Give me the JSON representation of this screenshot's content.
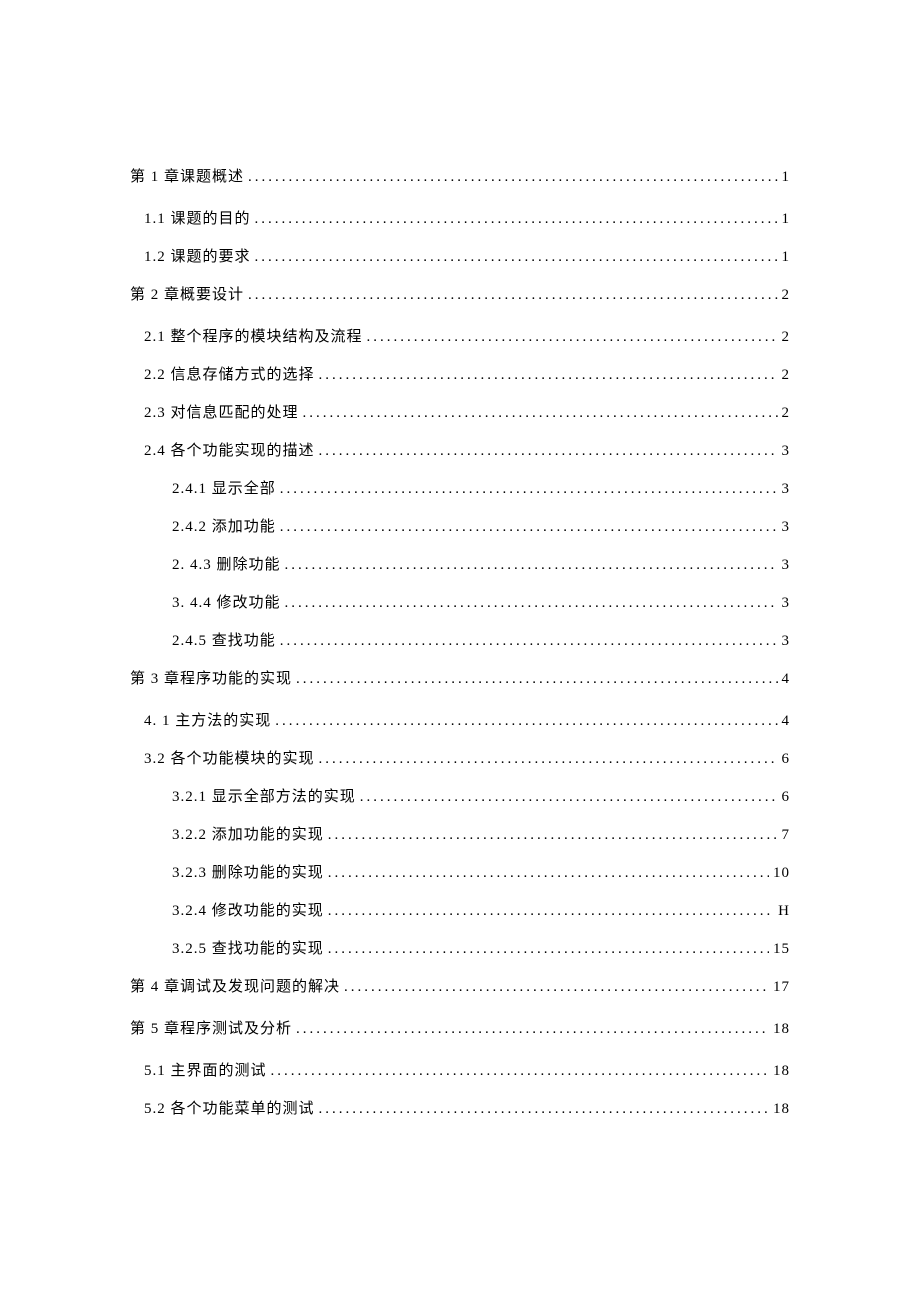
{
  "toc": [
    {
      "level": 0,
      "title": "第 1 章课题概述",
      "page": "1"
    },
    {
      "level": 1,
      "title": "1.1  课题的目的",
      "page": "1"
    },
    {
      "level": 1,
      "title": "1.2  课题的要求",
      "page": "1"
    },
    {
      "level": 0,
      "title": "第 2 章概要设计",
      "page": "2"
    },
    {
      "level": 1,
      "title": "2.1 整个程序的模块结构及流程",
      "page": "2"
    },
    {
      "level": 1,
      "title": "2.2 信息存储方式的选择",
      "page": "2"
    },
    {
      "level": 1,
      "title": "2.3 对信息匹配的处理",
      "page": "2"
    },
    {
      "level": 1,
      "title": "2.4 各个功能实现的描述",
      "page": "3"
    },
    {
      "level": 2,
      "title": "2.4.1 显示全部",
      "page": "3"
    },
    {
      "level": 2,
      "title": "2.4.2 添加功能",
      "page": "3"
    },
    {
      "level": 2,
      "title": "2.  4.3 删除功能",
      "page": "3"
    },
    {
      "level": 2,
      "title": "3.  4.4 修改功能",
      "page": "3"
    },
    {
      "level": 2,
      "title": "2.4.5 查找功能",
      "page": "3"
    },
    {
      "level": 0,
      "title": "第 3 章程序功能的实现",
      "page": "4"
    },
    {
      "level": 1,
      "title": "4.  1 主方法的实现",
      "page": "4"
    },
    {
      "level": 1,
      "title": "3.2 各个功能模块的实现",
      "page": "6"
    },
    {
      "level": 2,
      "title": "3.2.1 显示全部方法的实现",
      "page": "6"
    },
    {
      "level": 2,
      "title": "3.2.2 添加功能的实现",
      "page": "7"
    },
    {
      "level": 2,
      "title": "3.2.3 删除功能的实现",
      "page": "10"
    },
    {
      "level": 2,
      "title": "3.2.4 修改功能的实现",
      "page": "H"
    },
    {
      "level": 2,
      "title": "3.2.5 查找功能的实现",
      "page": "15"
    },
    {
      "level": 0,
      "title": "第 4 章调试及发现问题的解决",
      "page": "17"
    },
    {
      "level": 0,
      "title": "第 5 章程序测试及分析",
      "page": "18"
    },
    {
      "level": 1,
      "title": "5.1  主界面的测试",
      "page": "18"
    },
    {
      "level": 1,
      "title": "5.2  各个功能菜单的测试",
      "page": "18"
    }
  ]
}
